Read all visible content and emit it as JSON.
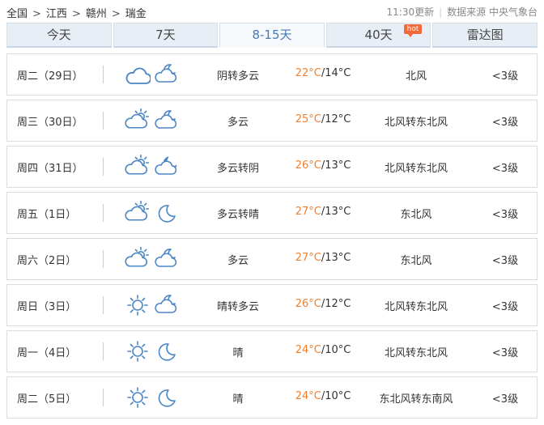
{
  "breadcrumb": {
    "items": [
      "全国",
      "江西",
      "赣州",
      "瑞金"
    ],
    "separator": ">"
  },
  "meta": {
    "update_time": "11:30更新",
    "source_label": "数据来源 中央气象台"
  },
  "tabs": [
    {
      "label": "今天",
      "active": false
    },
    {
      "label": "7天",
      "active": false
    },
    {
      "label": "8-15天",
      "active": true
    },
    {
      "label": "40天",
      "active": false,
      "badge": "hot"
    },
    {
      "label": "雷达图",
      "active": false
    }
  ],
  "forecast": [
    {
      "date": "周二（29日）",
      "icons": [
        "cloud-icon",
        "partly-cloudy-night-icon"
      ],
      "desc": "阴转多云",
      "high": "22°C",
      "low": "/14°C",
      "wind": "北风",
      "level": "<3级"
    },
    {
      "date": "周三（30日）",
      "icons": [
        "partly-cloudy-day-icon",
        "partly-cloudy-night-icon"
      ],
      "desc": "多云",
      "high": "25°C",
      "low": "/12°C",
      "wind": "北风转东北风",
      "level": "<3级"
    },
    {
      "date": "周四（31日）",
      "icons": [
        "partly-cloudy-day-icon",
        "cloud-moon-icon"
      ],
      "desc": "多云转阴",
      "high": "26°C",
      "low": "/13°C",
      "wind": "北风转东北风",
      "level": "<3级"
    },
    {
      "date": "周五（1日）",
      "icons": [
        "partly-cloudy-day-icon",
        "moon-icon"
      ],
      "desc": "多云转晴",
      "high": "27°C",
      "low": "/13°C",
      "wind": "东北风",
      "level": "<3级"
    },
    {
      "date": "周六（2日）",
      "icons": [
        "partly-cloudy-day-icon",
        "partly-cloudy-night-icon"
      ],
      "desc": "多云",
      "high": "27°C",
      "low": "/13°C",
      "wind": "东北风",
      "level": "<3级"
    },
    {
      "date": "周日（3日）",
      "icons": [
        "sun-icon",
        "partly-cloudy-night-icon"
      ],
      "desc": "晴转多云",
      "high": "26°C",
      "low": "/12°C",
      "wind": "北风转东北风",
      "level": "<3级"
    },
    {
      "date": "周一（4日）",
      "icons": [
        "sun-icon",
        "moon-icon"
      ],
      "desc": "晴",
      "high": "24°C",
      "low": "/10°C",
      "wind": "北风转东北风",
      "level": "<3级"
    },
    {
      "date": "周二（5日）",
      "icons": [
        "sun-icon",
        "moon-icon"
      ],
      "desc": "晴",
      "high": "24°C",
      "low": "/10°C",
      "wind": "东北风转东南风",
      "level": "<3级"
    }
  ],
  "colors": {
    "icon_blue": "#4a86c5",
    "high_temp": "#f0802e",
    "tab_active": "#4a7ab8",
    "hot_badge": "#f36a3a"
  }
}
